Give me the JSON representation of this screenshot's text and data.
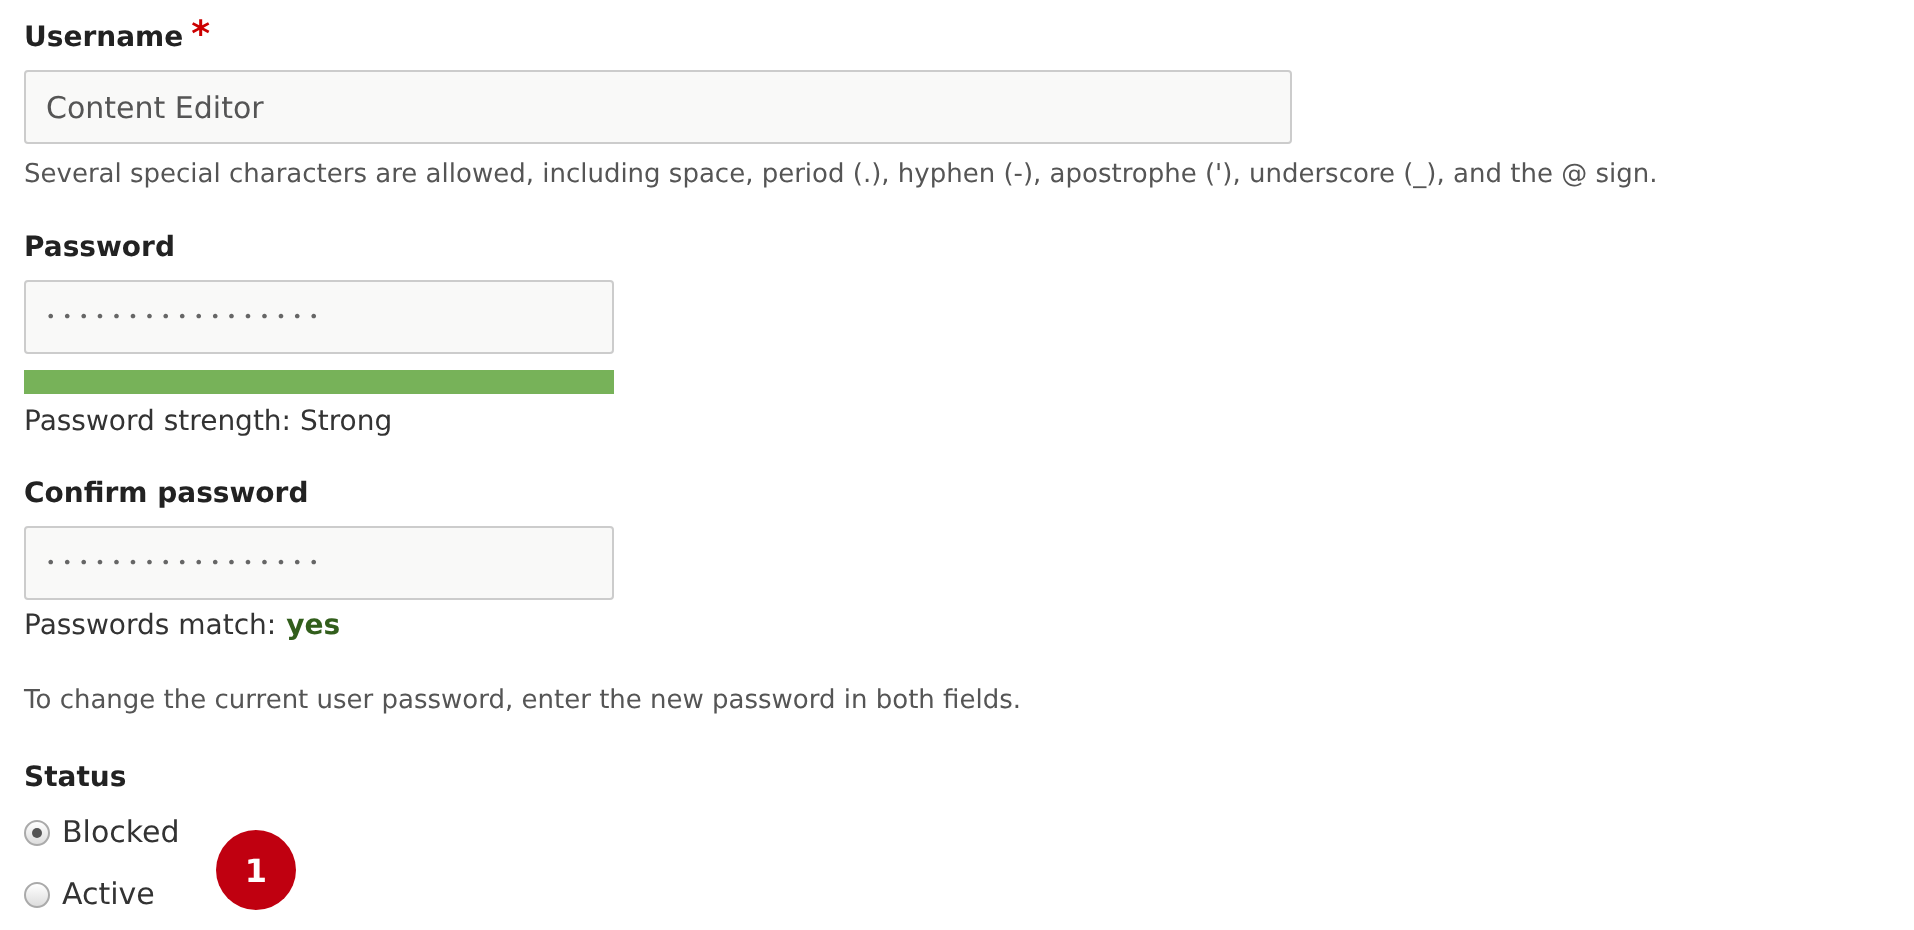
{
  "username": {
    "label": "Username",
    "required_mark": "*",
    "value": "Content Editor",
    "description": "Several special characters are allowed, including space, period (.), hyphen (-), apostrophe ('), underscore (_), and the @ sign."
  },
  "password": {
    "label": "Password",
    "value": "•••••••••••••••••",
    "strength": {
      "level": 1.0,
      "text": "Password strength: Strong"
    }
  },
  "confirm_password": {
    "label": "Confirm password",
    "value": "•••••••••••••••••",
    "match_label": "Passwords match:",
    "match_value": "yes"
  },
  "help_text": "To change the current user password, enter the new password in both fields.",
  "status": {
    "label": "Status",
    "options": [
      {
        "label": "Blocked",
        "selected": true
      },
      {
        "label": "Active",
        "selected": false
      }
    ]
  },
  "callout_badge": "1"
}
